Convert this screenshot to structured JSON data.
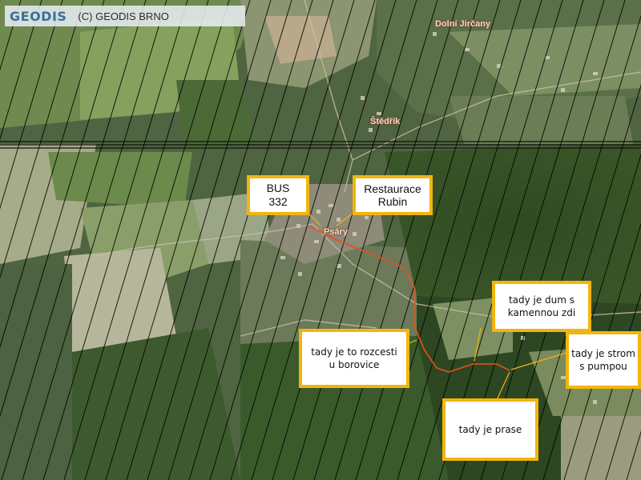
{
  "header": {
    "logo_text": "GEODIS",
    "copyright": "(C) GEODIS BRNO"
  },
  "places": {
    "dolni_jircany": "Dolní Jirčany",
    "strednik": "Štědřík",
    "psary": "Psáry"
  },
  "callouts": {
    "bus": [
      "BUS",
      "332"
    ],
    "restaurant": [
      "Restaurace",
      "Rubin"
    ],
    "house": [
      "tady je dum s",
      "kamennou zdi"
    ],
    "crossroad": [
      "tady je to rozcesti",
      "u borovice"
    ],
    "tree": [
      "tady je strom",
      "s pumpou"
    ],
    "pig": [
      "tady je prase"
    ]
  },
  "colors": {
    "callout_border": "#f2b50f",
    "route": "#e8501e",
    "leader": "#f2b50f",
    "hatch": "#000000"
  }
}
